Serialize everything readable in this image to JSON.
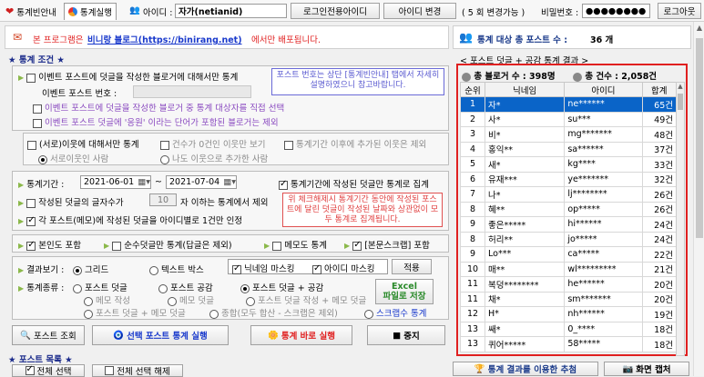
{
  "tabs": [
    {
      "label": "통계빈안내",
      "icon": "heart-icon"
    },
    {
      "label": "통계실행",
      "icon": "pie-chart-icon"
    }
  ],
  "header": {
    "id_label": "아이디 :",
    "id_value": "자가(netianid)",
    "login_other_button": "로그인전용아이디",
    "change_id_button": "아이디 변경",
    "change_count_text": "( 5 회 변경가능 )",
    "password_label": "비밀번호 :",
    "password_value": "●●●●●●●●",
    "logout_button": "로그아웃"
  },
  "notice": {
    "prefix": "본 프로그램은 ",
    "link": "비니랑 블로그(https://binirang.net)",
    "suffix": "에서만 배포됩니다."
  },
  "conditions": {
    "title": "★ 통계 조건 ★",
    "opt_comment_only": "이벤트 포스트에 덧글을 작성한 블로거에 대해서만 통계",
    "event_post_no_label": "이벤트 포스트 번호 :",
    "hint": "포스트 번호는 상단 [통계빈안내] 탭에서 자세히 설명하였으니 참고바랍니다.",
    "opt_direct_select": "이벤트 포스트에 덧글을 작성한 블로거 중 통계 대상자를 직접 선택",
    "opt_exclude_word": "이벤트 포스트 덧글에 '응원' 이라는 단어가 포함된 블로거는 제외",
    "opt_neighbor": "(서로)이웃에 대해서만 통계",
    "opt_zero_show": "건수가 0건인 이웃만 보기",
    "opt_added_exclude": "통계기간 이후에 추가된 이웃은 제외",
    "radio_mutual": "서로이웃인 사람",
    "radio_me_added": "나도 이웃으로 추가한 사람",
    "period_label": "통계기간 :",
    "date_from": "2021-06-01",
    "date_to": "2021-07-04",
    "tilde": "~",
    "opt_period_only": "통계기간에 작성된 덧글만 통계로 집계",
    "opt_len_prefix": "작성된 덧글의 글자수가",
    "len_value": "10",
    "opt_len_suffix": "자 이하는 통계에서 제외",
    "hint2": "위 체크해제시 통계기간 동안에 작성된 포스트에 달린 덧글이 작성된 날짜와 상관없이 모두 통계로 집계됩니다.",
    "opt_per_post": "각 포스트(메모)에 작성된 덧글을 아이디별로 1건만 인정",
    "opt_include_self": "본인도 포함",
    "opt_pure_comment": "순수덧글만 통계(답글은 제외)",
    "opt_memo_stats": "메모도 통계",
    "opt_scrap": "[본문스크랩] 포함",
    "view_label": "결과보기 :",
    "view_grid": "그리드",
    "view_textbox": "텍스트 박스",
    "mask_nick": "닉네임 마스킹",
    "mask_id": "아이디 마스킹",
    "apply": "적용",
    "kind_label": "통계종류 :",
    "kind_post_comment": "포스트 덧글",
    "kind_post_like": "포스트 공감",
    "kind_post_comment_like": "포스트 덧글 + 공감",
    "kind_memo_write": "메모 작성",
    "kind_memo_comment": "메모 덧글",
    "kind_post_memo_write": "포스트 덧글 작성 + 메모 덧글",
    "kind_post_comment_memo": "포스트 덧글 + 메모 덧글",
    "kind_total": "종합(모두 합산 - 스크랩은 제외)",
    "kind_scrap": "스크랩수 통계",
    "excel_line1": "Excel",
    "excel_line2": "파일로 저장"
  },
  "actions": {
    "search_posts": "포스트 조회",
    "run_selected": "선택 포스트 통계 실행",
    "run_now": "통계 바로 실행",
    "stop": "중지"
  },
  "postlist": {
    "title": "★ 포스트 목록 ★",
    "select_all": "전체 선택",
    "deselect_all": "전체 선택 해제"
  },
  "stats": {
    "target_label": "통계 대상 총 포스트 수 :",
    "target_value": "36 개",
    "result_caption": "< 포스트 덧글 + 공감 통계 결과 >",
    "total_bloggers": "총 블로거 수 : 398명",
    "total_count": "총 건수 : 2,058건",
    "columns": [
      "순위",
      "닉네임",
      "아이디",
      "합계"
    ],
    "rows": [
      [
        "1",
        "자*",
        "ne******",
        "65건"
      ],
      [
        "2",
        "사*",
        "su***",
        "49건"
      ],
      [
        "3",
        "비*",
        "mg*******",
        "48건"
      ],
      [
        "4",
        "홍익**",
        "sa******",
        "37건"
      ],
      [
        "5",
        "새*",
        "kg****",
        "33건"
      ],
      [
        "6",
        "유재***",
        "ye*******",
        "32건"
      ],
      [
        "7",
        "나*",
        "lj********",
        "26건"
      ],
      [
        "8",
        "혜**",
        "op*****",
        "26건"
      ],
      [
        "9",
        "좋은*****",
        "hi******",
        "24건"
      ],
      [
        "8",
        "허리**",
        "jo*****",
        "24건"
      ],
      [
        "9",
        "Lo***",
        "ca*****",
        "22건"
      ],
      [
        "10",
        "매**",
        "wl*********",
        "21건"
      ],
      [
        "11",
        "복덩********",
        "he******",
        "20건"
      ],
      [
        "11",
        "채*",
        "sm*******",
        "20건"
      ],
      [
        "12",
        "H*",
        "nh******",
        "19건"
      ],
      [
        "13",
        "쌔*",
        "0_****",
        "18건"
      ],
      [
        "13",
        "퀴어*****",
        "58*****",
        "18건"
      ]
    ],
    "footer_run": "통계 결과를 이용한 추첨",
    "footer_capture": "화면 캡처"
  },
  "colors": {
    "accent": "#e02020",
    "link": "#1a3acc",
    "selected_row": "#0a64c8"
  }
}
